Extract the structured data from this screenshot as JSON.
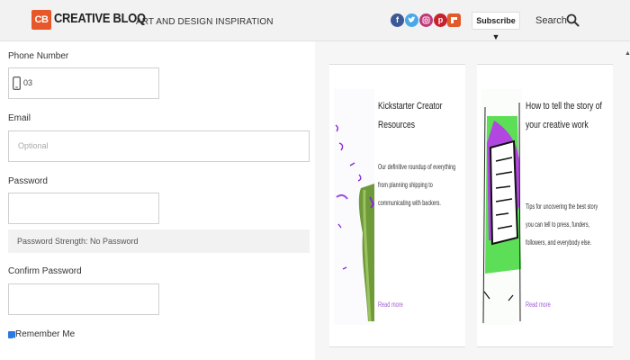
{
  "header": {
    "logo_mark": "CB",
    "logo_text": "CREATIVE BLOQ",
    "tagline": "ART AND DESIGN INSPIRATION",
    "social_icons": [
      "facebook-icon",
      "twitter-icon",
      "instagram-icon",
      "pinterest-icon",
      "flipboard-icon"
    ],
    "subscribe_label": "Subscribe ▼",
    "search_label": "Search"
  },
  "form": {
    "phone": {
      "label": "Phone Number",
      "value": "03"
    },
    "email": {
      "label": "Email",
      "placeholder": "Optional"
    },
    "password": {
      "label": "Password"
    },
    "strength_text": "Password Strength: No Password",
    "confirm": {
      "label": "Confirm Password"
    },
    "remember": {
      "label": "Remember Me",
      "checked": true
    }
  },
  "cards": [
    {
      "title": "Kickstarter Creator Resources",
      "description": "Our definitive roundup of everything from planning shipping to communicating with backers.",
      "link": "Read more"
    },
    {
      "title": "How to tell the story of your creative work",
      "description": "Tips for uncovering the best story you can tell to press, funders, followers, and everybody else.",
      "link": "Read more"
    }
  ],
  "colors": {
    "brand": "#e8572a",
    "header_bg": "#f2f2f2",
    "link": "#a25dd6",
    "checkbox": "#2a7ae2"
  }
}
